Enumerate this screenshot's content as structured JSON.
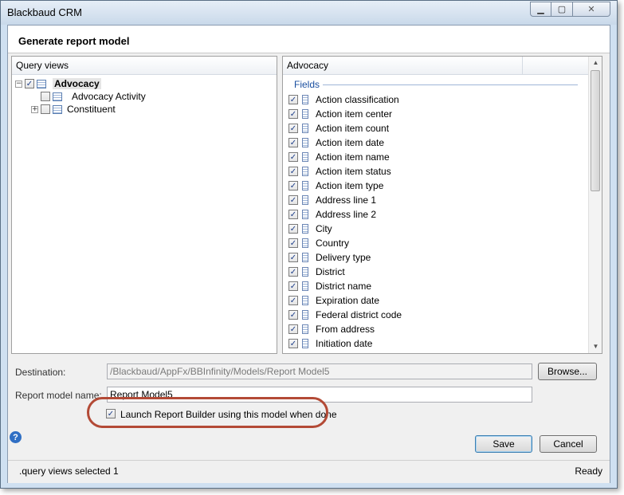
{
  "window": {
    "title": "Blackbaud CRM"
  },
  "dialog": {
    "heading": "Generate report model"
  },
  "query_views": {
    "header": "Query views",
    "tree": [
      {
        "label": "Advocacy",
        "expander": "−",
        "checked": true,
        "bold": true
      },
      {
        "label": "Advocacy Activity",
        "expander": "",
        "checked": false
      },
      {
        "label": "Constituent",
        "expander": "+",
        "checked": false
      }
    ]
  },
  "fields_panel": {
    "header": "Advocacy",
    "section_label": "Fields",
    "fields": [
      "Action classification",
      "Action item center",
      "Action item count",
      "Action item date",
      "Action item name",
      "Action item status",
      "Action item type",
      "Address line 1",
      "Address line 2",
      "City",
      "Country",
      "Delivery type",
      "District",
      "District name",
      "Expiration date",
      "Federal district code",
      "From address",
      "Initiation date"
    ]
  },
  "destination": {
    "label": "Destination:",
    "value": "/Blackbaud/AppFx/BBInfinity/Models/Report Model5",
    "browse_label": "Browse..."
  },
  "report_model_name": {
    "label": "Report model name:",
    "value": "Report Model5"
  },
  "launch_option": {
    "label": "Launch Report Builder using this model when done",
    "checked": true
  },
  "actions": {
    "save_label": "Save",
    "cancel_label": "Cancel"
  },
  "status": {
    "left_text": ".query views selected 1",
    "right_text": "Ready"
  },
  "colors": {
    "highlight": "#b34a36",
    "accent": "#1a4fa0"
  }
}
